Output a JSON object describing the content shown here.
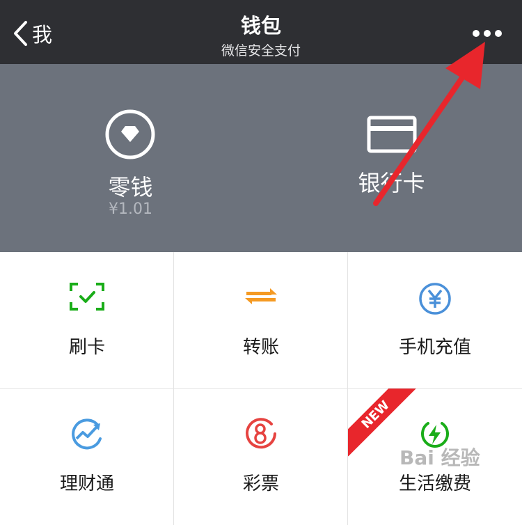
{
  "navbar": {
    "back_label": "我",
    "title": "钱包",
    "subtitle": "微信安全支付"
  },
  "header": {
    "change": {
      "label": "零钱",
      "amount": "¥1.01",
      "icon": "diamond-circle-icon"
    },
    "bank_card": {
      "label": "银行卡",
      "icon": "card-icon"
    }
  },
  "services": [
    {
      "label": "刷卡",
      "icon": "scan-pay-icon",
      "color": "#1aad19"
    },
    {
      "label": "转账",
      "icon": "transfer-icon",
      "color": "#f59a23"
    },
    {
      "label": "手机充值",
      "icon": "yuan-icon",
      "color": "#4a90d9"
    },
    {
      "label": "理财通",
      "icon": "chart-icon",
      "color": "#4a9be0"
    },
    {
      "label": "彩票",
      "icon": "lottery-icon",
      "color": "#e64340"
    },
    {
      "label": "生活缴费",
      "icon": "lightning-icon",
      "color": "#1aad19",
      "badge": "NEW"
    }
  ],
  "watermark": "Bai 经验",
  "colors": {
    "navbar": "#2e2f33",
    "header": "#6c727c",
    "annotation_arrow": "#e8262c"
  }
}
